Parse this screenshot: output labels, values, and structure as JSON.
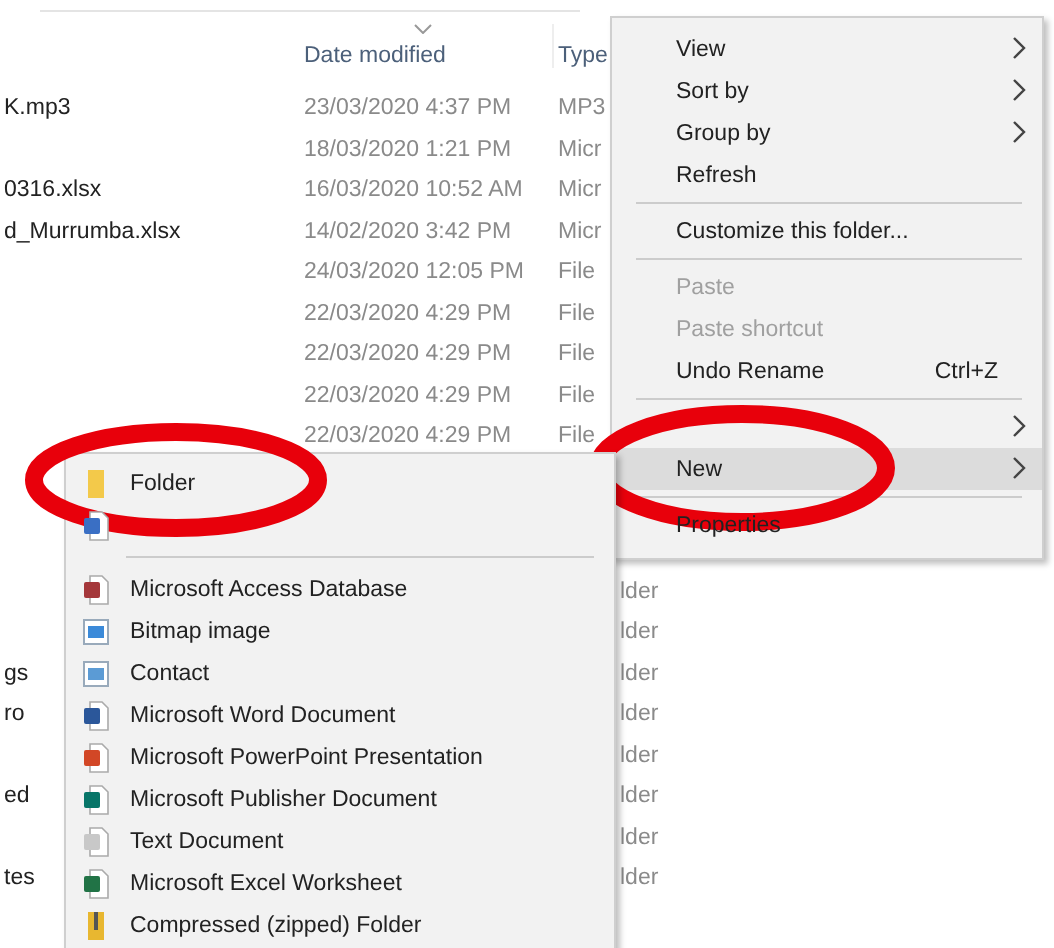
{
  "columns": [
    {
      "label": "Date modified",
      "sorted": true
    },
    {
      "label": "Type",
      "sorted": false
    }
  ],
  "rows": [
    {
      "name": "K.mp3",
      "date": "23/03/2020 4:37 PM",
      "type": "MP3"
    },
    {
      "name": "",
      "date": "18/03/2020 1:21 PM",
      "type": "Micr"
    },
    {
      "name": "0316.xlsx",
      "date": "16/03/2020 10:52 AM",
      "type": "Micr"
    },
    {
      "name": "d_Murrumba.xlsx",
      "date": "14/02/2020 3:42 PM",
      "type": "Micr"
    },
    {
      "name": "",
      "date": "24/03/2020 12:05 PM",
      "type": "File"
    },
    {
      "name": "",
      "date": "22/03/2020 4:29 PM",
      "type": "File"
    },
    {
      "name": "",
      "date": "22/03/2020 4:29 PM",
      "type": "File"
    },
    {
      "name": "",
      "date": "22/03/2020 4:29 PM",
      "type": "File"
    },
    {
      "name": "",
      "date": "22/03/2020 4:29 PM",
      "type": "File"
    }
  ],
  "lower_rows": [
    {
      "name": "",
      "type": "lder"
    },
    {
      "name": "",
      "type": "lder"
    },
    {
      "name": "gs",
      "type": "lder"
    },
    {
      "name": "ro",
      "type": "lder"
    },
    {
      "name": "",
      "type": "lder"
    },
    {
      "name": "ed",
      "type": "lder"
    },
    {
      "name": "",
      "type": "lder"
    },
    {
      "name": "tes",
      "type": "lder"
    }
  ],
  "context_menu": [
    {
      "kind": "item",
      "label": "View",
      "submenu": true,
      "disabled": false,
      "selected": false
    },
    {
      "kind": "item",
      "label": "Sort by",
      "submenu": true,
      "disabled": false,
      "selected": false
    },
    {
      "kind": "item",
      "label": "Group by",
      "submenu": true,
      "disabled": false,
      "selected": false
    },
    {
      "kind": "item",
      "label": "Refresh",
      "submenu": false,
      "disabled": false,
      "selected": false
    },
    {
      "kind": "separator"
    },
    {
      "kind": "item",
      "label": "Customize this folder...",
      "submenu": false,
      "disabled": false,
      "selected": false
    },
    {
      "kind": "separator"
    },
    {
      "kind": "item",
      "label": "Paste",
      "submenu": false,
      "disabled": true,
      "selected": false
    },
    {
      "kind": "item",
      "label": "Paste shortcut",
      "submenu": false,
      "disabled": true,
      "selected": false
    },
    {
      "kind": "item",
      "label": "Undo Rename",
      "shortcut": "Ctrl+Z",
      "submenu": false,
      "disabled": false,
      "selected": false
    },
    {
      "kind": "separator"
    },
    {
      "kind": "item",
      "submenu": true,
      "selected": false
    },
    {
      "kind": "item",
      "label": "New",
      "submenu": true,
      "disabled": false,
      "selected": true,
      "highlight": true
    },
    {
      "kind": "separator"
    },
    {
      "kind": "item",
      "label": "Properties",
      "submenu": false,
      "disabled": false,
      "selected": false
    }
  ],
  "new_submenu": [
    {
      "kind": "folder",
      "label": "Folder",
      "highlight": true
    },
    {
      "kind": "shortcut"
    },
    {
      "kind": "separator"
    },
    {
      "kind": "access",
      "label": "Microsoft Access Database"
    },
    {
      "kind": "bitmap",
      "label": "Bitmap image"
    },
    {
      "kind": "contact",
      "label": "Contact"
    },
    {
      "kind": "word",
      "label": "Microsoft Word Document"
    },
    {
      "kind": "powerpoint",
      "label": "Microsoft PowerPoint Presentation"
    },
    {
      "kind": "publisher",
      "label": "Microsoft Publisher Document"
    },
    {
      "kind": "text",
      "label": "Text Document"
    },
    {
      "kind": "excel",
      "label": "Microsoft Excel Worksheet"
    },
    {
      "kind": "zip",
      "label": "Compressed (zipped) Folder"
    }
  ]
}
